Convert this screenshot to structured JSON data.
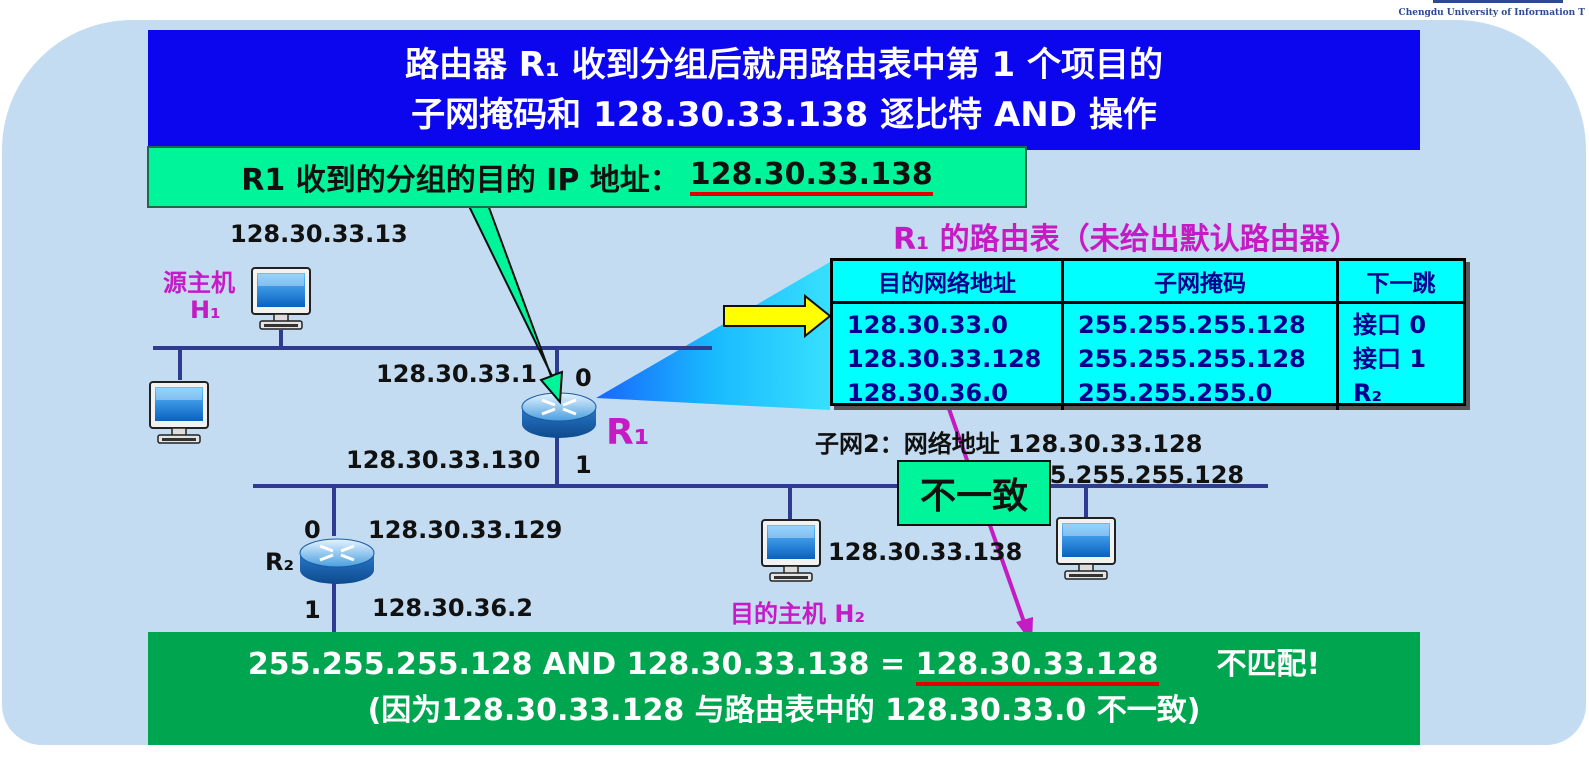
{
  "logo": {
    "subtitle": "Chengdu University of Information T"
  },
  "top_banner": {
    "line1": "路由器 R₁ 收到分组后就用路由表中第 1 个项目的",
    "line2": "子网掩码和 128.30.33.138 逐比特 AND 操作"
  },
  "ip_box": {
    "label": "R1 收到的分组的目的 IP 地址：",
    "address": "128.30.33.138"
  },
  "hosts": {
    "h1_ip": "128.30.33.13",
    "h1_label1": "源主机",
    "h1_label2": "H₁",
    "h2_ip": "128.30.33.138",
    "h2_label": "目的主机 H₂"
  },
  "router1": {
    "name": "R₁",
    "if0_ip": "128.30.33.1",
    "if0": "0",
    "if1_ip": "128.30.33.130",
    "if1": "1"
  },
  "router2": {
    "name": "R₂",
    "if0": "0",
    "if0_ip": "128.30.33.129",
    "if1": "1",
    "if1_ip": "128.30.36.2"
  },
  "subnet2": {
    "line1": "子网2：网络地址 128.30.33.128",
    "line2": "子网掩码 255.255.255.128"
  },
  "routing_table": {
    "title": "R₁ 的路由表（未给出默认路由器）",
    "headers": [
      "目的网络地址",
      "子网掩码",
      "下一跳"
    ],
    "rows": [
      [
        "128.30.33.0",
        "255.255.255.128",
        "接口 0"
      ],
      [
        "128.30.33.128",
        "255.255.255.128",
        "接口 1"
      ],
      [
        "128.30.36.0",
        "255.255.255.0",
        "R₂"
      ]
    ]
  },
  "mismatch_label": "不一致",
  "bottom_banner": {
    "expr": "255.255.255.128 AND 128.30.33.138 = ",
    "result": "128.30.33.128",
    "verdict": "不匹配!",
    "line2": "(因为128.30.33.128 与路由表中的 128.30.33.0 不一致)"
  },
  "colors": {
    "banner_blue": "#0c06ee",
    "green_box": "#00f59a",
    "bottom_green": "#00a550",
    "table_cyan": "#00ffff",
    "magenta": "#c51bc5",
    "underline_red": "#e00000",
    "net_line": "#2e3b8f"
  }
}
